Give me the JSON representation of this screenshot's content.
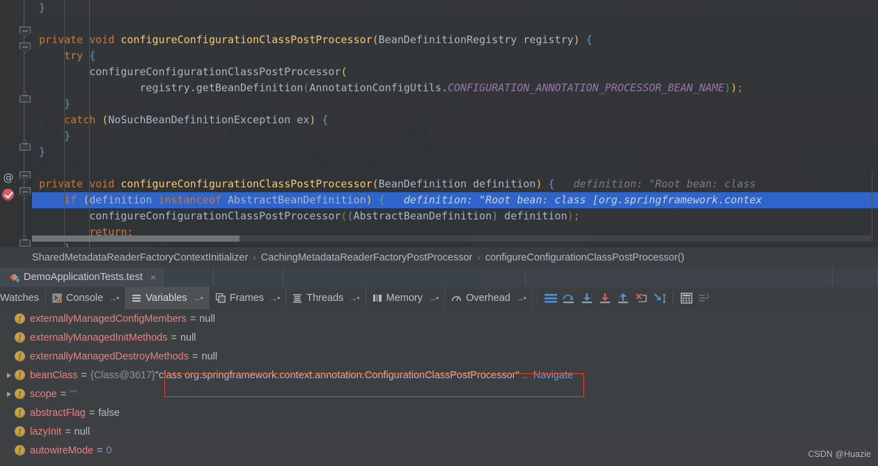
{
  "editor": {
    "lines": [
      {
        "indent": 0,
        "tokens": [
          {
            "t": "}",
            "c": "par-b"
          }
        ]
      },
      {
        "indent": 0,
        "tokens": []
      },
      {
        "indent": 0,
        "tokens": [
          {
            "t": "private",
            "c": "kw"
          },
          {
            "t": " ",
            "c": "txt"
          },
          {
            "t": "void",
            "c": "kw"
          },
          {
            "t": " ",
            "c": "txt"
          },
          {
            "t": "configureConfigurationClassPostProcessor",
            "c": "mth"
          },
          {
            "t": "(",
            "c": "par-y"
          },
          {
            "t": "BeanDefinitionRegistry registry",
            "c": "txt"
          },
          {
            "t": ")",
            "c": "par-y"
          },
          {
            "t": " ",
            "c": "txt"
          },
          {
            "t": "{",
            "c": "par-b"
          }
        ]
      },
      {
        "indent": 0,
        "tokens": [
          {
            "t": "    ",
            "c": "txt"
          },
          {
            "t": "try",
            "c": "kw"
          },
          {
            "t": " ",
            "c": "txt"
          },
          {
            "t": "{",
            "c": "par-b"
          }
        ]
      },
      {
        "indent": 0,
        "tokens": [
          {
            "t": "        configureConfigurationClassPostProcessor",
            "c": "txt"
          },
          {
            "t": "(",
            "c": "par-y"
          }
        ]
      },
      {
        "indent": 0,
        "tokens": [
          {
            "t": "                registry.getBeanDefinition",
            "c": "txt"
          },
          {
            "t": "(",
            "c": "par-g"
          },
          {
            "t": "AnnotationConfigUtils.",
            "c": "txt"
          },
          {
            "t": "CONFIGURATION_ANNOTATION_PROCESSOR_BEAN_NAME",
            "c": "const"
          },
          {
            "t": ")",
            "c": "par-g"
          },
          {
            "t": ")",
            "c": "par-y"
          },
          {
            "t": ";",
            "c": "semi"
          }
        ]
      },
      {
        "indent": 0,
        "tokens": [
          {
            "t": "    ",
            "c": "txt"
          },
          {
            "t": "}",
            "c": "par-b"
          }
        ]
      },
      {
        "indent": 0,
        "tokens": [
          {
            "t": "    ",
            "c": "txt"
          },
          {
            "t": "catch",
            "c": "kw"
          },
          {
            "t": " ",
            "c": "txt"
          },
          {
            "t": "(",
            "c": "par-y"
          },
          {
            "t": "NoSuchBeanDefinitionException ex",
            "c": "txt"
          },
          {
            "t": ")",
            "c": "par-y"
          },
          {
            "t": " ",
            "c": "txt"
          },
          {
            "t": "{",
            "c": "par-b"
          }
        ]
      },
      {
        "indent": 0,
        "tokens": [
          {
            "t": "    ",
            "c": "txt"
          },
          {
            "t": "}",
            "c": "par-b"
          }
        ]
      },
      {
        "indent": 0,
        "tokens": [
          {
            "t": "",
            "c": "txt"
          },
          {
            "t": "}",
            "c": "par-b"
          }
        ]
      },
      {
        "indent": 0,
        "tokens": []
      },
      {
        "indent": 0,
        "tokens": [
          {
            "t": "private",
            "c": "kw"
          },
          {
            "t": " ",
            "c": "txt"
          },
          {
            "t": "void",
            "c": "kw"
          },
          {
            "t": " ",
            "c": "txt"
          },
          {
            "t": "configureConfigurationClassPostProcessor",
            "c": "mth"
          },
          {
            "t": "(",
            "c": "par-y"
          },
          {
            "t": "BeanDefinition definition",
            "c": "txt"
          },
          {
            "t": ")",
            "c": "par-y"
          },
          {
            "t": " ",
            "c": "txt"
          },
          {
            "t": "{",
            "c": "par-b"
          },
          {
            "t": "   definition: \"Root bean: class",
            "c": "hint"
          }
        ]
      },
      {
        "indent": 0,
        "selected": true,
        "tokens": [
          {
            "t": "    ",
            "c": "txt"
          },
          {
            "t": "if",
            "c": "kw"
          },
          {
            "t": " ",
            "c": "txt"
          },
          {
            "t": "(",
            "c": "par-y"
          },
          {
            "t": "definition",
            "c": "txt"
          },
          {
            "t": " ",
            "c": "txt"
          },
          {
            "t": "instanceof",
            "c": "kw"
          },
          {
            "t": " ",
            "c": "txt"
          },
          {
            "t": "AbstractBeanDefinition",
            "c": "txt"
          },
          {
            "t": ")",
            "c": "par-y"
          },
          {
            "t": " ",
            "c": "txt"
          },
          {
            "t": "{",
            "c": "par-b"
          },
          {
            "t": "   definition: \"Root bean: class [org.springframework.contex",
            "c": "hint-sel"
          }
        ]
      },
      {
        "indent": 0,
        "tokens": [
          {
            "t": "        configureConfigurationClassPostProcessor",
            "c": "txt"
          },
          {
            "t": "(",
            "c": "par-g"
          },
          {
            "t": "(",
            "c": "par-b"
          },
          {
            "t": "AbstractBeanDefinition",
            "c": "txt"
          },
          {
            "t": ")",
            "c": "par-b"
          },
          {
            "t": " definition",
            "c": "txt"
          },
          {
            "t": ")",
            "c": "par-g"
          },
          {
            "t": ";",
            "c": "semi"
          }
        ]
      },
      {
        "indent": 0,
        "tokens": [
          {
            "t": "        ",
            "c": "txt"
          },
          {
            "t": "return",
            "c": "kw"
          },
          {
            "t": ";",
            "c": "semi"
          }
        ]
      },
      {
        "indent": 0,
        "tokens": [
          {
            "t": "    ",
            "c": "txt"
          },
          {
            "t": "}",
            "c": "par-b"
          }
        ]
      }
    ],
    "gutter": {
      "annotation_icon": "at-icon",
      "breakpoint_icon": "breakpoint-verified-icon"
    }
  },
  "breadcrumb": {
    "items": [
      "SharedMetadataReaderFactoryContextInitializer",
      "CachingMetadataReaderFactoryPostProcessor",
      "configureConfigurationClassPostProcessor()"
    ],
    "separator": "›"
  },
  "run_tabs": {
    "tabs": [
      {
        "label": "DemoApplicationTests.test",
        "icon": "intellij-run-icon",
        "close": "×"
      }
    ]
  },
  "debug_toolbar": {
    "tabs": [
      {
        "label": "Watches",
        "icon": "",
        "pinned": false,
        "active": false
      },
      {
        "label": "Console",
        "icon": "console-icon",
        "pinned": true,
        "active": false
      },
      {
        "label": "Variables",
        "icon": "variables-icon",
        "pinned": true,
        "active": true
      },
      {
        "label": "Frames",
        "icon": "frames-icon",
        "pinned": true,
        "active": false
      },
      {
        "label": "Threads",
        "icon": "threads-icon",
        "pinned": true,
        "active": false
      },
      {
        "label": "Memory",
        "icon": "memory-icon",
        "pinned": true,
        "active": false
      },
      {
        "label": "Overhead",
        "icon": "overhead-icon",
        "pinned": true,
        "active": false
      }
    ],
    "pin_glyph": "→•",
    "buttons": [
      {
        "name": "show-execution-point-icon"
      },
      {
        "name": "step-over-icon"
      },
      {
        "name": "step-into-icon"
      },
      {
        "name": "force-step-into-icon"
      },
      {
        "name": "step-out-icon"
      },
      {
        "name": "drop-frame-icon"
      },
      {
        "name": "run-to-cursor-icon"
      },
      {
        "name": "evaluate-expression-icon"
      },
      {
        "name": "show-as-list-icon"
      }
    ]
  },
  "variables": {
    "rows": [
      {
        "expandable": false,
        "icon": "field-icon",
        "name": "externallyManagedConfigMembers",
        "eq": "=",
        "value": "null",
        "value_class": "vval"
      },
      {
        "expandable": false,
        "icon": "field-icon",
        "name": "externallyManagedInitMethods",
        "eq": "=",
        "value": "null",
        "value_class": "vval"
      },
      {
        "expandable": false,
        "icon": "field-icon",
        "name": "externallyManagedDestroyMethods",
        "eq": "=",
        "value": "null",
        "value_class": "vval"
      },
      {
        "expandable": true,
        "icon": "field-icon",
        "name": "beanClass",
        "eq": "=",
        "ref": "{Class@3617}",
        "value": "\"class org.springframework.context.annotation.ConfigurationClassPostProcessor\"",
        "ellipsis": "..",
        "link": "Navigate",
        "value_class": "vval",
        "highlighted": true
      },
      {
        "expandable": true,
        "icon": "field-icon",
        "name": "scope",
        "eq": "=",
        "value": "\"\"",
        "value_class": "vempty"
      },
      {
        "expandable": false,
        "icon": "field-icon",
        "name": "abstractFlag",
        "eq": "=",
        "value": "false",
        "value_class": "vval"
      },
      {
        "expandable": false,
        "icon": "field-icon",
        "name": "lazyInit",
        "eq": "=",
        "value": "null",
        "value_class": "vval"
      },
      {
        "expandable": false,
        "icon": "field-icon",
        "name": "autowireMode",
        "eq": "=",
        "value": "0",
        "value_class": "vnum"
      }
    ],
    "field_glyph": "f",
    "highlight_color": "#f03c2e"
  },
  "watermark": {
    "text": "CSDN @Huazie"
  },
  "colors": {
    "editor_bg": "#313335",
    "panel_bg": "#3c3f41",
    "selection": "#2f65ca",
    "keyword": "#cc7832",
    "method": "#ffc66d",
    "constant": "#9876aa",
    "text": "#a9b7c6",
    "var_name": "#e8827f",
    "link": "#6a9fd4",
    "highlight_box": "#f03c2e"
  }
}
